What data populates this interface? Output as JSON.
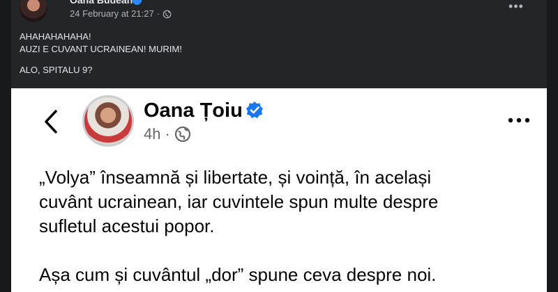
{
  "post": {
    "author": "Oana Budeanu",
    "timestamp": "24 February at 21:27",
    "audience_icon": "globe-icon",
    "menu_icon": "more-options-icon",
    "text_lines": [
      "AHAHAHAHAHA!",
      "AUZI E CUVANT UCRAINEAN! MURIM!",
      "ALO, SPITALU 9?"
    ]
  },
  "shared": {
    "back_icon": "chevron-left-icon",
    "author": "Oana Țoiu",
    "verified_icon": "verified-badge-icon",
    "time": "4h",
    "separator": "·",
    "audience_icon": "globe-icon",
    "menu_icon": "more-options-icon",
    "paragraph1": [
      "„Volya” înseamnă și libertate, și voință, în același",
      "cuvânt ucrainean, iar cuvintele spun multe despre",
      "sufletul acestui popor."
    ],
    "paragraph2": "Așa cum și cuvântul „dor” spune ceva despre noi."
  },
  "colors": {
    "dark_bg": "#18191a",
    "card_bg": "#242526",
    "verified_blue": "#2d88ff",
    "embed_verified_blue": "#1877f2"
  }
}
